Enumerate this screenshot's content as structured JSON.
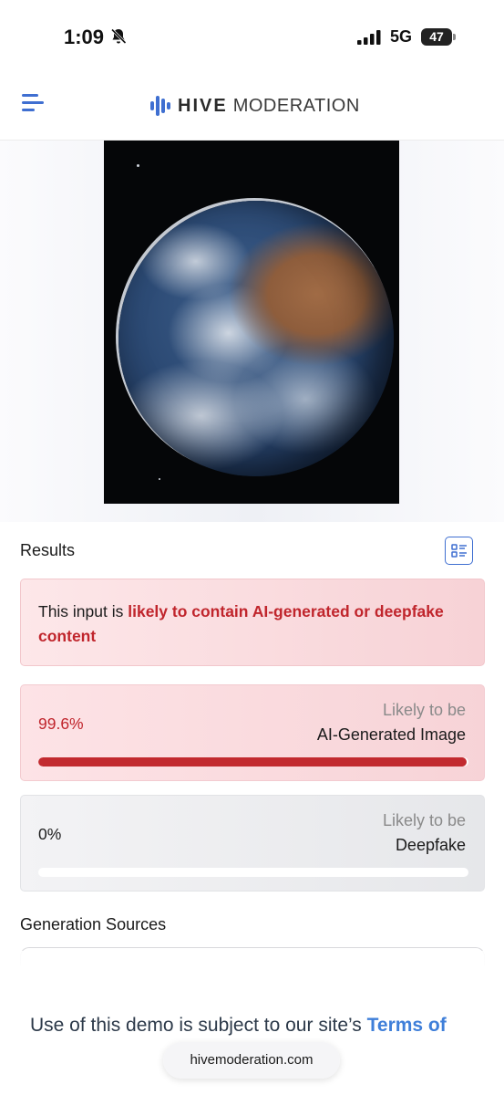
{
  "status_bar": {
    "time": "1:09",
    "network": "5G",
    "battery": "47",
    "battery_level": 0.47
  },
  "header": {
    "logo_bold": "HIVE",
    "logo_rest": "MODERATION",
    "accent_color": "#3f6fd1"
  },
  "icons": {
    "menu": "hamburger-menu-icon",
    "list": "list-view-icon",
    "bell": "bell-slash-icon"
  },
  "results": {
    "title": "Results",
    "alert": {
      "prefix": "This input is ",
      "highlight": "likely to contain AI-generated or deepfake content"
    },
    "scores": [
      {
        "percent": "99.6%",
        "value": 0.996,
        "likely": "Likely to be",
        "label": "AI-Generated Image",
        "color": "#c22a2f"
      },
      {
        "percent": "0%",
        "value": 0,
        "likely": "Likely to be",
        "label": "Deepfake",
        "color": "#c22a2f"
      }
    ],
    "generation_sources_title": "Generation Sources"
  },
  "footer": {
    "terms_prefix": "Use of this demo is subject to our site’s ",
    "terms_link": "Terms of",
    "url": "hivemoderation.com"
  }
}
